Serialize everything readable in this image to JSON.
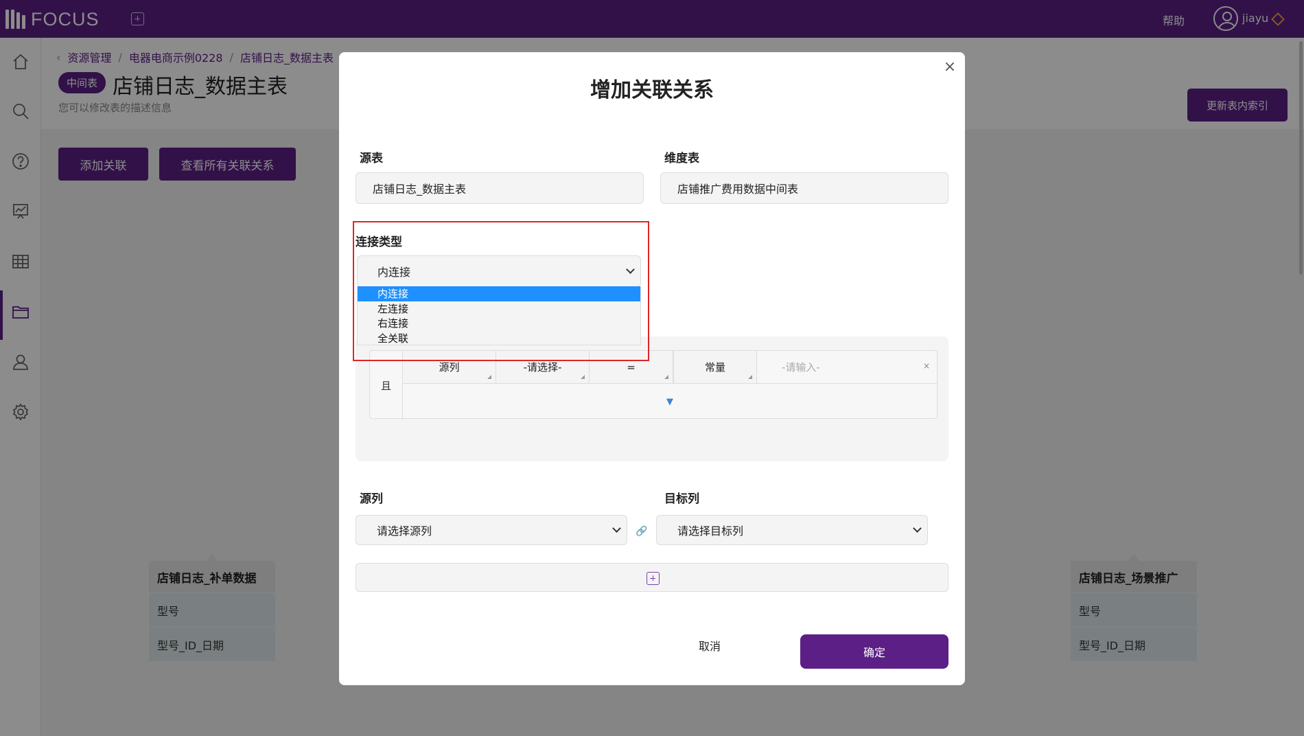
{
  "app": {
    "logo_text": "FOCUS",
    "help": "帮助",
    "username": "jiayu"
  },
  "sidebar": {
    "items": [
      "home-icon",
      "search-icon",
      "help-icon",
      "dashboard-icon",
      "table-icon",
      "folder-icon",
      "user-icon",
      "settings-icon"
    ],
    "active": "folder-icon"
  },
  "breadcrumb": [
    "资源管理",
    "电器电商示例0228",
    "店铺日志_数据主表"
  ],
  "page": {
    "badge": "中间表",
    "title": "店铺日志_数据主表",
    "description": "您可以修改表的描述信息",
    "reindex_button": "更新表内索引",
    "add_relation_button": "添加关联",
    "view_relations_button": "查看所有关联关系"
  },
  "cards": [
    {
      "title": "店铺日志_补单数据",
      "rows": [
        "型号",
        "型号_ID_日期"
      ]
    },
    {
      "title": "店铺日志_场景推广",
      "rows": [
        "型号",
        "型号_ID_日期"
      ]
    }
  ],
  "modal": {
    "title": "增加关联关系",
    "close": "×",
    "source_table_label": "源表",
    "source_table_value": "店铺日志_数据主表",
    "dimension_table_label": "维度表",
    "dimension_table_value": "店铺推广费用数据中间表",
    "join_type_label": "连接类型",
    "join_type_value": "内连接",
    "join_type_options": [
      "内连接",
      "左连接",
      "右连接",
      "全关联"
    ],
    "join_type_selected_index": 0,
    "condition": {
      "logic": "且",
      "source_col": "源列",
      "select": "-请选择-",
      "operator": "=",
      "constant": "常量",
      "input_placeholder": "-请输入-",
      "clear": "×",
      "expand": "▼"
    },
    "source_col_label": "源列",
    "source_col_placeholder": "请选择源列",
    "target_col_label": "目标列",
    "target_col_placeholder": "请选择目标列",
    "cancel_button": "取消",
    "confirm_button": "确定"
  }
}
